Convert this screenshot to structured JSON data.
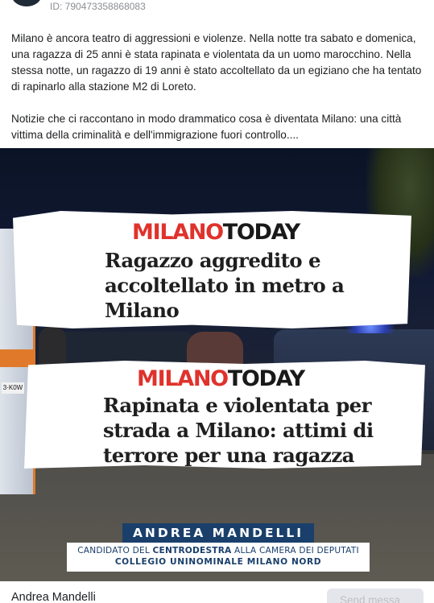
{
  "post": {
    "id_text": "ID: 790473358868083",
    "paragraphs": [
      "Milano è ancora teatro di aggressioni e violenze. Nella notte tra sabato e domenica, una ragazza di 25 anni è stata rapinata e violentata da un uomo marocchino. Nella stessa notte, un ragazzo di 19 anni è stato accoltellato da un egiziano che ha tentato di rapinarlo alla stazione M2 di Loreto.",
      "Notizie che ci raccontano in modo drammatico cosa è diventata Milano: una città vittima della criminalità e dell'immigrazione fuori controllo...."
    ]
  },
  "image": {
    "plate_text": "3·K0W",
    "clip1": {
      "brand_red": "MILANO",
      "brand_dark": "TODAY",
      "headline_lines": [
        "Ragazzo aggredito e",
        "accoltellato in metro a",
        "Milano"
      ]
    },
    "clip2": {
      "brand_red": "MILANO",
      "brand_dark": "TODAY",
      "headline_lines": [
        "Rapinata e violentata per",
        "strada a Milano: attimi di",
        "terrore per una ragazza"
      ]
    },
    "banner": {
      "name": "ANDREA MANDELLI",
      "line1_pre": "CANDIDATO DEL ",
      "line1_bold": "CENTRODESTRA",
      "line1_post": " ALLA CAMERA DEI DEPUTATI",
      "line2": "COLLEGIO UNINOMINALE MILANO NORD"
    }
  },
  "footer": {
    "page_name": "Andrea Mandelli",
    "send_button": "Send messa"
  },
  "colors": {
    "brand_red": "#e0322c",
    "banner_blue": "#1a3f6b",
    "button_bg": "#e4e6eb"
  }
}
